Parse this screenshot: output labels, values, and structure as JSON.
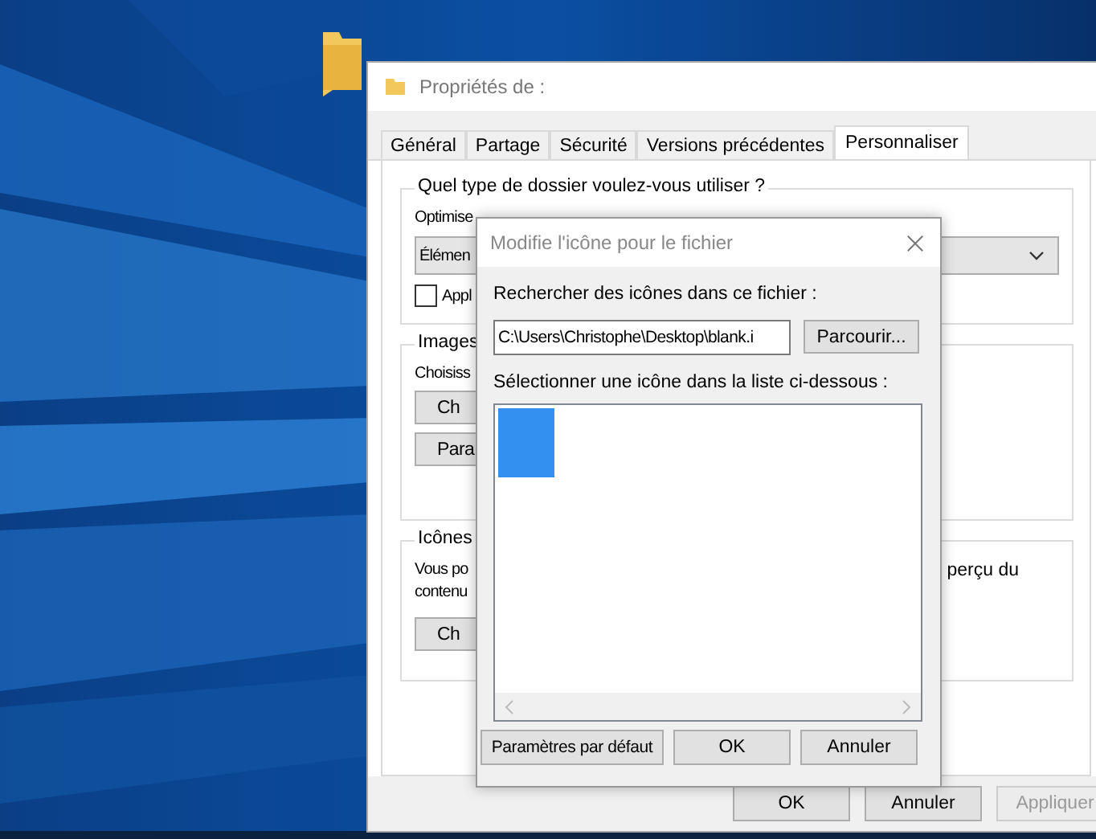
{
  "properties_window": {
    "title": "Propriétés de :",
    "tabs": [
      {
        "label": "Général",
        "selected": false
      },
      {
        "label": "Partage",
        "selected": false
      },
      {
        "label": "Sécurité",
        "selected": false
      },
      {
        "label": "Versions précédentes",
        "selected": false
      },
      {
        "label": "Personnaliser",
        "selected": true
      }
    ],
    "folder_type_group": {
      "legend": "Quel type de dossier voulez-vous utiliser ?",
      "optimize_label": "Optimise",
      "dropdown_value": "Élémen",
      "checkbox": {
        "label": "Appl",
        "checked": false
      }
    },
    "images_group": {
      "legend": "Images",
      "text": "Choisiss",
      "buttons": [
        "Ch",
        "Para"
      ]
    },
    "icons_group": {
      "legend": "Icônes",
      "text_left": "Vous po",
      "text_right": "perçu du",
      "text_line_2": "contenu",
      "buttons": [
        "Ch"
      ]
    },
    "buttons": [
      {
        "label": "OK",
        "disabled": false
      },
      {
        "label": "Annuler",
        "disabled": false
      },
      {
        "label": "Appliquer",
        "disabled": true
      }
    ]
  },
  "icon_dialog": {
    "title": "Modifie l'icône pour le fichier",
    "active": false,
    "search_label": "Rechercher des icônes dans ce fichier :",
    "file_field": "C:\\Users\\Christophe\\Desktop\\blank.i",
    "browse_button": "Parcourir...",
    "list_label": "Sélectionner une icône dans la liste ci-dessous :",
    "icons": [
      {
        "selected": true
      }
    ],
    "buttons": [
      "Paramètres par défaut",
      "OK",
      "Annuler"
    ]
  }
}
